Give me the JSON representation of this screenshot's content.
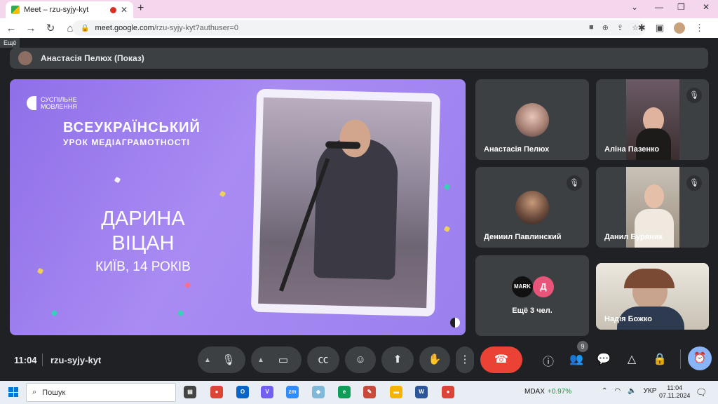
{
  "browser": {
    "tab_title": "Meet – rzu-syjy-kyt",
    "tab_close": "✕",
    "new_tab": "+",
    "url_host": "meet.google.com",
    "url_path": "/rzu-syjy-kyt?authuser=0",
    "window_controls": [
      "⌄",
      "—",
      "❐",
      "✕"
    ]
  },
  "meet": {
    "more_tooltip": "Ещё",
    "presenter_label": "Анастасія Пелюх (Показ)",
    "presentation": {
      "brand_line1": "СУСПІЛЬНЕ",
      "brand_line2": "МОВЛЕННЯ",
      "title_line1": "ВСЕУКРАЇНСЬКИЙ",
      "title_line2": "УРОК МЕДІАГРАМОТНОСТІ",
      "name_line1": "ДАРИНА",
      "name_line2": "ВІЦАН",
      "city_age": "КИЇВ, 14 РОКІВ"
    },
    "participants": [
      {
        "name": "Анастасія Пелюх",
        "muted": false
      },
      {
        "name": "Аліна Пазенко",
        "muted": true
      },
      {
        "name": "Дениил Павлинский",
        "muted": true
      },
      {
        "name": "Данил Буряник",
        "muted": true
      },
      {
        "name": "Надія Божко",
        "muted": false
      }
    ],
    "more_people": {
      "label": "Ещё 3 чел.",
      "avatar1": "MARK",
      "avatar2": "Д"
    },
    "bottom": {
      "time": "11:04",
      "meeting_code": "rzu-syjy-kyt",
      "people_count": "9"
    }
  },
  "taskbar": {
    "search_placeholder": "Пошук",
    "ticker_name": "MDAX",
    "ticker_change": "+0.97%",
    "language": "УКР",
    "time": "11:04",
    "date": "07.11.2024"
  },
  "colors": {
    "meet_bg": "#202124",
    "tile_bg": "#3c4043",
    "hangup": "#ea4335",
    "slide_purple": "#a98bf3",
    "accent_blue": "#8ab4f8"
  }
}
